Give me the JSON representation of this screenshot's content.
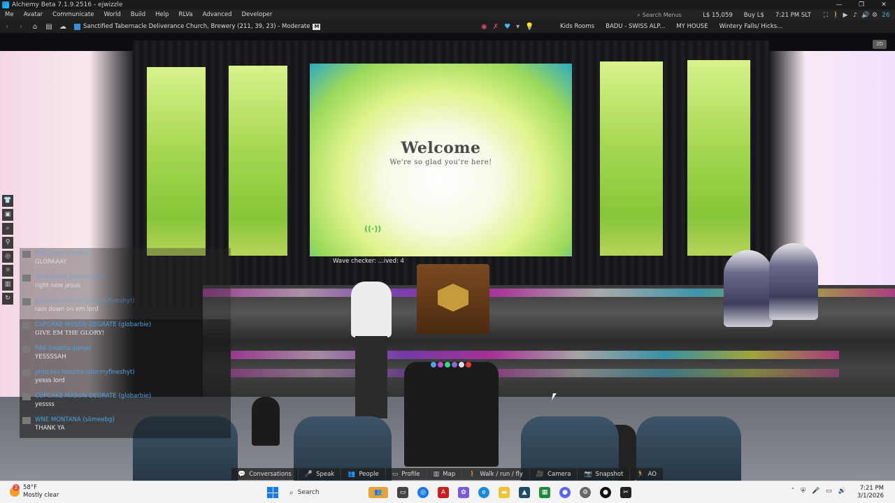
{
  "window": {
    "title": "Alchemy Beta 7.1.9.2516 - ejwizzle",
    "controls": [
      "—",
      "❐",
      "✕"
    ]
  },
  "menubar": {
    "items": [
      "Me",
      "Avatar",
      "Communicate",
      "World",
      "Build",
      "Help",
      "RLVa",
      "Advanced",
      "Developer"
    ],
    "search_placeholder": "Search Menus",
    "balance": "L$ 15,059",
    "buy": "Buy L$",
    "clock": "7:21 PM SLT",
    "fps": "26"
  },
  "navbar": {
    "location": "Sanctified Tabernacle Deliverance Church, Brewery (211, 39, 23) - Moderate",
    "maturity_badge": "M",
    "favorites": [
      "Kids Rooms",
      "BADU - SWISS ALP...",
      "MY HOUSE",
      "Wintery Falls/ Hicks..."
    ]
  },
  "scene": {
    "screen_title": "Welcome",
    "screen_subtitle": "We're so glad you're here!",
    "wave_checker": "Wave checker: ...ived: 4",
    "corner_button": "2D"
  },
  "chat": {
    "lines": [
      {
        "name": "RAE (motha.alpha)",
        "message": "GLORAAAY",
        "faint": true
      },
      {
        "name": "Tredayvion (sbambabyt)",
        "message": "right now jesus",
        "faint": true
      },
      {
        "name": "princess huncho (stormyfineshyt)",
        "message": "rain down on em lord",
        "faint": true
      },
      {
        "name": "CUPCAKE MASON DEGRATE (globarbie)",
        "message": "GIVE EM THE GLORY!",
        "faint": false
      },
      {
        "name": "RAE (motha.alpha)",
        "message": "YESSSSAH",
        "faint": false
      },
      {
        "name": "princess huncho (stormyfineshyt)",
        "message": "yesss lord",
        "faint": false
      },
      {
        "name": "CUPCAKE MASON DEGRATE (globarbie)",
        "message": "yessss",
        "faint": false
      },
      {
        "name": "WNE MONTANA (slimeebg)",
        "message": "THANK YA",
        "faint": false
      }
    ]
  },
  "bottombar": {
    "buttons": [
      {
        "label": "Conversations",
        "icon": "chat-icon"
      },
      {
        "label": "Speak",
        "icon": "microphone-icon"
      },
      {
        "label": "People",
        "icon": "people-icon"
      },
      {
        "label": "Profile",
        "icon": "profile-icon"
      },
      {
        "label": "Map",
        "icon": "map-icon"
      },
      {
        "label": "Walk / run / fly",
        "icon": "walk-icon"
      },
      {
        "label": "Camera",
        "icon": "camera-icon"
      },
      {
        "label": "Snapshot",
        "icon": "snapshot-icon"
      },
      {
        "label": "AO",
        "icon": "ao-icon"
      }
    ]
  },
  "taskbar": {
    "temperature": "58°F",
    "weather": "Mostly clear",
    "weather_badge": "2",
    "search_label": "Search",
    "time": "7:21 PM",
    "date": "3/1/2026"
  },
  "colors": {
    "chat_name": "#4fa3e0",
    "screen_title": "#4a4a4a",
    "accent_blue": "#1a7ae8"
  }
}
